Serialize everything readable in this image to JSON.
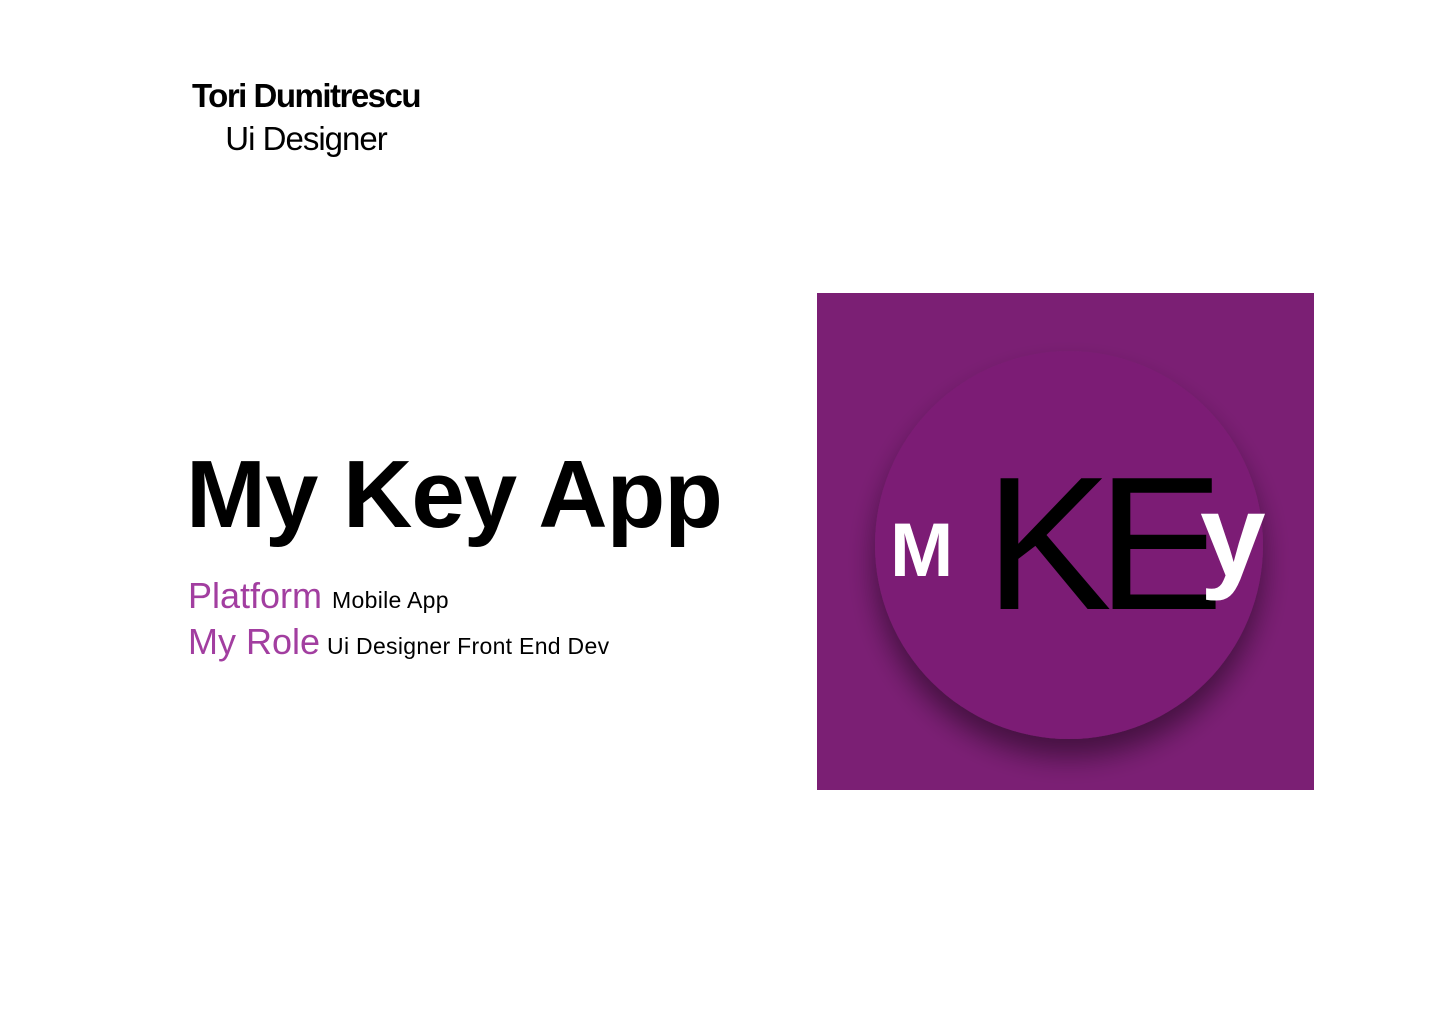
{
  "author": {
    "name": "Tori Dumitrescu",
    "role": "Ui Designer"
  },
  "project": {
    "title": "My Key App",
    "platform_label": "Platform",
    "platform_value": "Mobile App",
    "role_label": "My Role",
    "role_value": "Ui Designer Front End Dev"
  },
  "logo": {
    "letter_1": "M",
    "letter_2": "K",
    "letter_3": "E",
    "letter_4": "y"
  },
  "colors": {
    "brand_purple": "#7b1f74",
    "label_purple": "#a23ea0",
    "text": "#000000",
    "logo_light_letters": "#ffffff"
  }
}
